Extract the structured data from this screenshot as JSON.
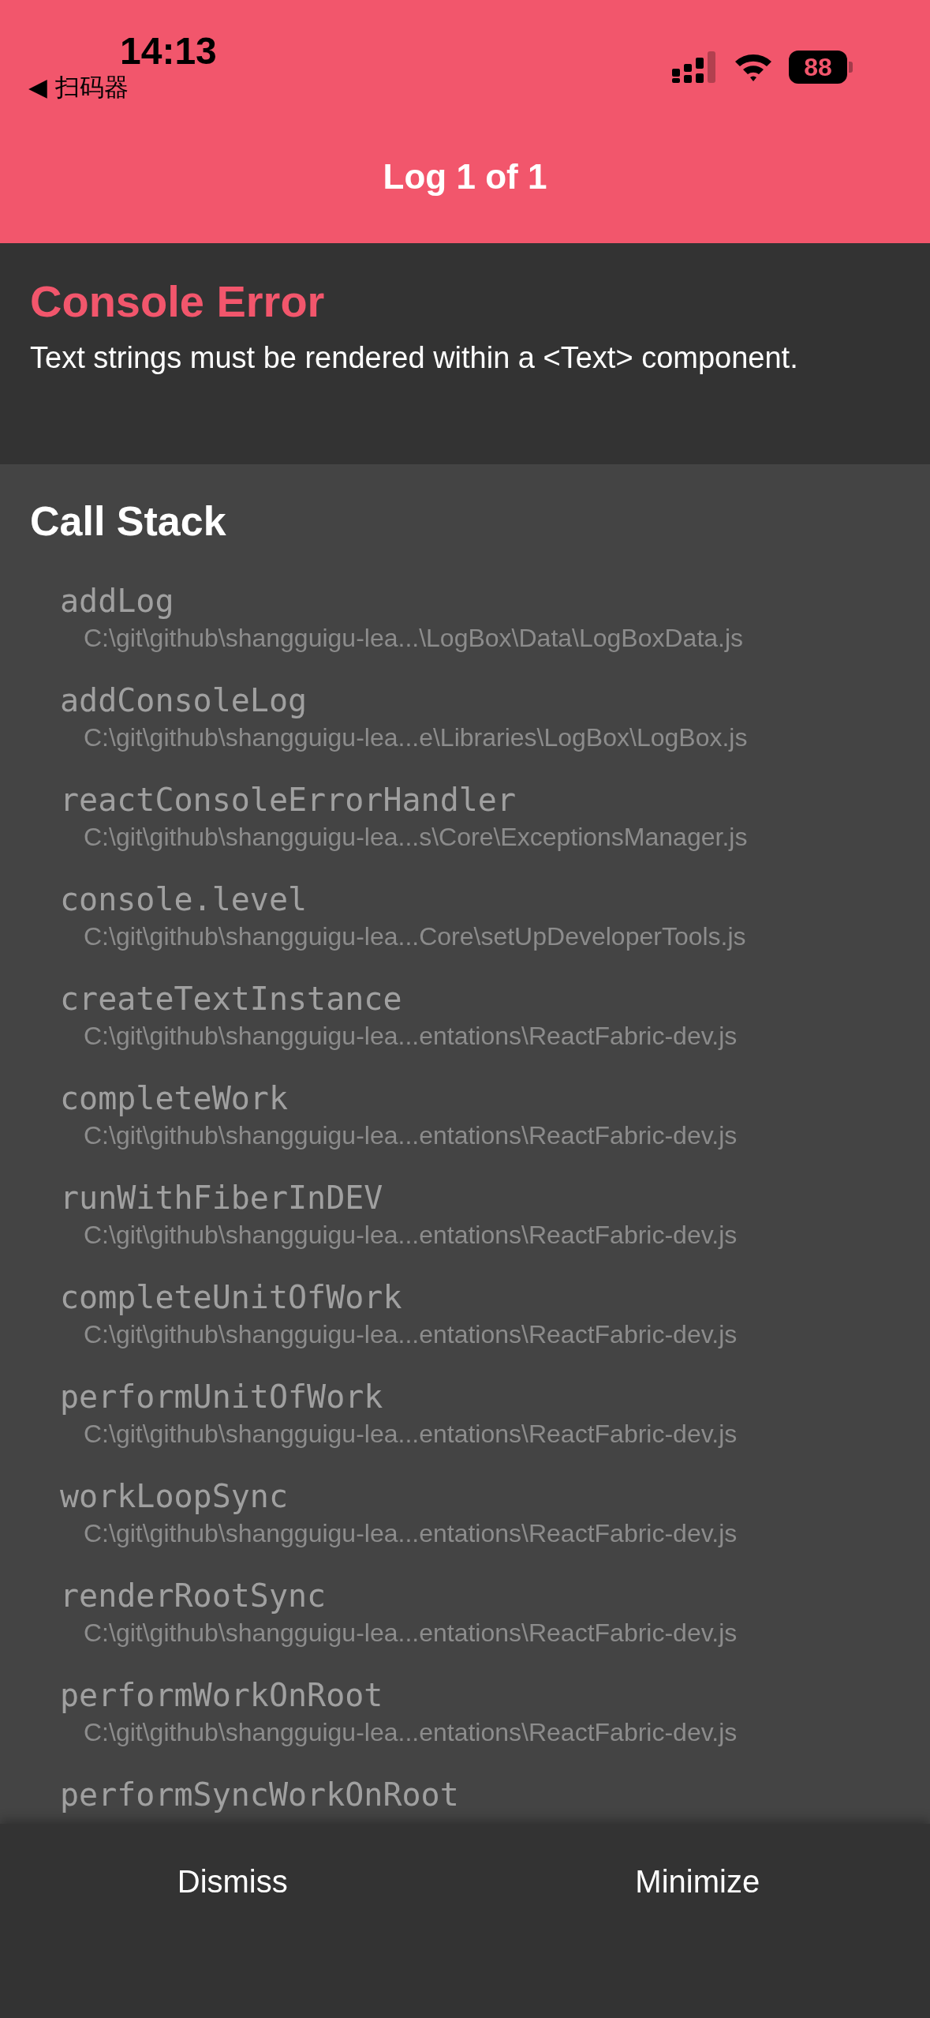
{
  "status_bar": {
    "time": "14:13",
    "back_label": "◀ 扫码器",
    "battery": "88"
  },
  "header": {
    "title": "Log 1 of 1"
  },
  "error": {
    "title": "Console Error",
    "message": "Text strings must be rendered within a <Text> component."
  },
  "call_stack": {
    "title": "Call Stack",
    "frames": [
      {
        "method": "addLog",
        "path": "C:\\git\\github\\shangguigu-lea...\\LogBox\\Data\\LogBoxData.js"
      },
      {
        "method": "addConsoleLog",
        "path": "C:\\git\\github\\shangguigu-lea...e\\Libraries\\LogBox\\LogBox.js"
      },
      {
        "method": "reactConsoleErrorHandler",
        "path": "C:\\git\\github\\shangguigu-lea...s\\Core\\ExceptionsManager.js"
      },
      {
        "method": "console.level",
        "path": "C:\\git\\github\\shangguigu-lea...Core\\setUpDeveloperTools.js"
      },
      {
        "method": "createTextInstance",
        "path": "C:\\git\\github\\shangguigu-lea...entations\\ReactFabric-dev.js"
      },
      {
        "method": "completeWork",
        "path": "C:\\git\\github\\shangguigu-lea...entations\\ReactFabric-dev.js"
      },
      {
        "method": "runWithFiberInDEV",
        "path": "C:\\git\\github\\shangguigu-lea...entations\\ReactFabric-dev.js"
      },
      {
        "method": "completeUnitOfWork",
        "path": "C:\\git\\github\\shangguigu-lea...entations\\ReactFabric-dev.js"
      },
      {
        "method": "performUnitOfWork",
        "path": "C:\\git\\github\\shangguigu-lea...entations\\ReactFabric-dev.js"
      },
      {
        "method": "workLoopSync",
        "path": "C:\\git\\github\\shangguigu-lea...entations\\ReactFabric-dev.js"
      },
      {
        "method": "renderRootSync",
        "path": "C:\\git\\github\\shangguigu-lea...entations\\ReactFabric-dev.js"
      },
      {
        "method": "performWorkOnRoot",
        "path": "C:\\git\\github\\shangguigu-lea...entations\\ReactFabric-dev.js"
      },
      {
        "method": "performSyncWorkOnRoot"
      }
    ]
  },
  "buttons": [
    "Dismiss",
    "Minimize"
  ]
}
